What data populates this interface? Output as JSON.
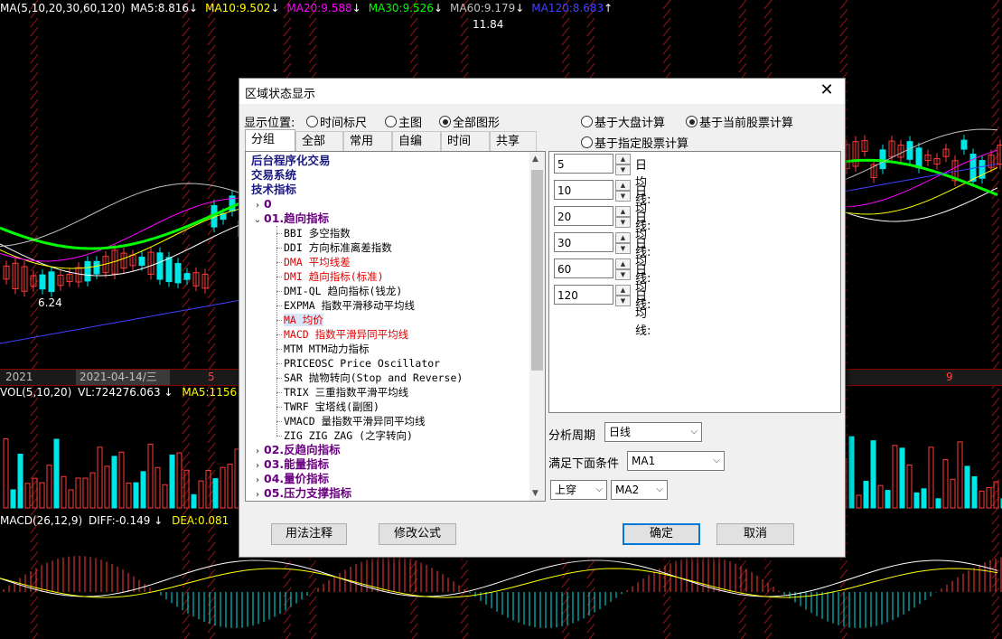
{
  "chart": {
    "ma_line": {
      "title": "MA(5,10,20,30,60,120)",
      "items": [
        {
          "text": "MA5:8.816",
          "arrow": "↓",
          "color": "#ffffff"
        },
        {
          "text": "MA10:9.502",
          "arrow": "↓",
          "color": "#ffff00"
        },
        {
          "text": "MA20:9.588",
          "arrow": "↓",
          "color": "#ff00ff"
        },
        {
          "text": "MA30:9.526",
          "arrow": "↓",
          "color": "#00ff00"
        },
        {
          "text": "MA60:9.179",
          "arrow": "↓",
          "color": "#c0c0c0"
        },
        {
          "text": "MA120:8.683",
          "arrow": "↑",
          "color": "#4040ff"
        }
      ]
    },
    "high_label": "11.84",
    "low_label": "6.24",
    "datebar": {
      "year": "2021",
      "cursor_date": "2021-04-14/三",
      "m5": "5",
      "m9": "9"
    },
    "vol_line": {
      "title": "VOL(5,10,20)",
      "vl": "VL:724276.063",
      "arrow": "↓",
      "ma5": "MA5:1156"
    },
    "macd_line": {
      "title": "MACD(26,12,9)",
      "diff": "DIFF:-0.149",
      "arrow": "↓",
      "dea": "DEA:0.081"
    }
  },
  "dialog": {
    "title": "区域状态显示",
    "close": "✕",
    "position_label": "显示位置:",
    "position_options": [
      {
        "label": "时间标尺",
        "checked": false
      },
      {
        "label": "主图",
        "checked": false
      },
      {
        "label": "全部图形",
        "checked": true
      }
    ],
    "calc_options": [
      {
        "label": "基于大盘计算",
        "checked": false
      },
      {
        "label": "基于当前股票计算",
        "checked": true
      },
      {
        "label": "基于指定股票计算",
        "checked": false
      }
    ],
    "tabs": [
      "分组",
      "全部",
      "常用",
      "自编",
      "时间",
      "共享"
    ],
    "tree": {
      "top": [
        "后台程序化交易",
        "交易系统",
        "技术指标"
      ],
      "zero": "0",
      "cat_open": "01.趋向指标",
      "leaves": [
        {
          "text": "BBI 多空指数",
          "red": false,
          "hl": false
        },
        {
          "text": "DDI 方向标准离差指数",
          "red": false,
          "hl": false
        },
        {
          "text": "DMA 平均线差",
          "red": true,
          "hl": false
        },
        {
          "text": "DMI 趋向指标(标准)",
          "red": true,
          "hl": false
        },
        {
          "text": "DMI-QL 趋向指标(钱龙)",
          "red": false,
          "hl": false
        },
        {
          "text": "EXPMA 指数平滑移动平均线",
          "red": false,
          "hl": false
        },
        {
          "text": "MA 均价",
          "red": true,
          "hl": true
        },
        {
          "text": "MACD 指数平滑异同平均线",
          "red": true,
          "hl": false
        },
        {
          "text": "MTM MTM动力指标",
          "red": false,
          "hl": false
        },
        {
          "text": "PRICEOSC Price Oscillator",
          "red": false,
          "hl": false
        },
        {
          "text": "SAR 抛物转向(Stop and Reverse)",
          "red": false,
          "hl": false
        },
        {
          "text": "TRIX 三重指数平滑平均线",
          "red": false,
          "hl": false
        },
        {
          "text": "TWRF 宝塔线(副图)",
          "red": false,
          "hl": false
        },
        {
          "text": "VMACD 量指数平滑异同平均线",
          "red": false,
          "hl": false
        },
        {
          "text": "ZIG ZIG ZAG (之字转向)",
          "red": false,
          "hl": false
        }
      ],
      "cats_closed": [
        "02.反趋向指标",
        "03.能量指标",
        "04.量价指标",
        "05.压力支撑指标"
      ]
    },
    "params": [
      {
        "value": "5",
        "unit": "日均线:"
      },
      {
        "value": "10",
        "unit": "日均线:"
      },
      {
        "value": "20",
        "unit": "日均线:"
      },
      {
        "value": "30",
        "unit": "日均线:"
      },
      {
        "value": "60",
        "unit": "日均线:"
      },
      {
        "value": "120",
        "unit": "日均线:"
      }
    ],
    "period_label": "分析周期",
    "period_value": "日线",
    "condition_label": "满足下面条件",
    "cond_a": "MA1",
    "cond_op": "上穿",
    "cond_b": "MA2",
    "btn_usage": "用法注释",
    "btn_edit": "修改公式",
    "btn_ok": "确定",
    "btn_cancel": "取消"
  }
}
